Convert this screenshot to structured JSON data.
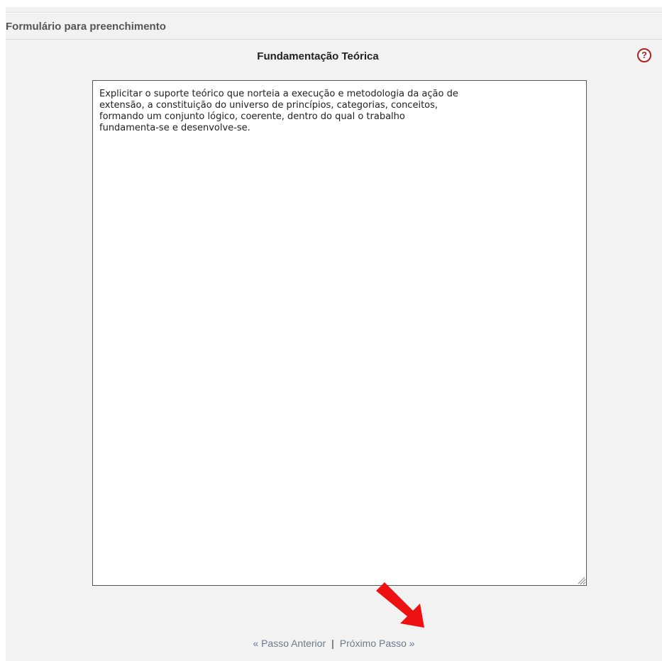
{
  "panel": {
    "header_title": "Formulário para preenchimento"
  },
  "section": {
    "title": "Fundamentação Teórica",
    "help_icon_symbol": "?"
  },
  "textarea": {
    "value": "Explicitar o suporte teórico que norteia a execução e metodologia da ação de\nextensão, a constituição do universo de princípios, categorias, conceitos,\nformando um conjunto lógico, coerente, dentro do qual o trabalho\nfundamenta-se e desenvolve-se."
  },
  "navigation": {
    "previous_label": "« Passo Anterior",
    "separator": "|",
    "next_label": "Próximo Passo »"
  },
  "annotation": {
    "arrow_color": "#ee1111"
  }
}
